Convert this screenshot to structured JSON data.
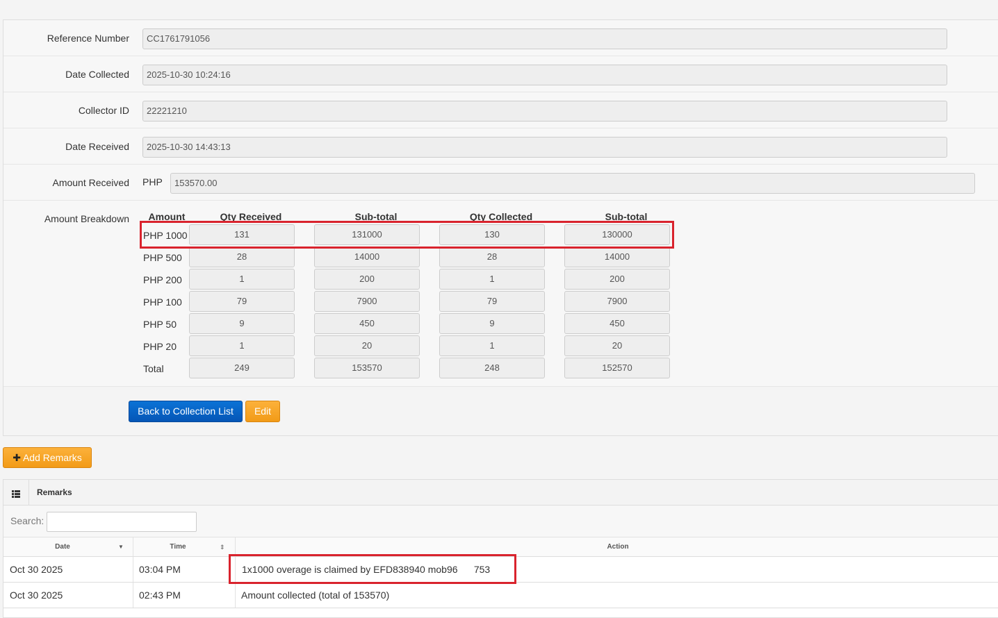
{
  "form": {
    "reference_number": {
      "label": "Reference Number",
      "value": "CC1761791056"
    },
    "date_collected": {
      "label": "Date Collected",
      "value": "2025-10-30 10:24:16"
    },
    "collector_id": {
      "label": "Collector ID",
      "value": "22221210"
    },
    "date_received": {
      "label": "Date Received",
      "value": "2025-10-30 14:43:13"
    },
    "amount_received": {
      "label": "Amount Received",
      "currency": "PHP",
      "value": "153570.00"
    }
  },
  "breakdown": {
    "label": "Amount Breakdown",
    "headers": [
      "Amount",
      "Qty Received",
      "Sub-total",
      "Qty Collected",
      "Sub-total"
    ],
    "rows": [
      {
        "amount": "PHP 1000",
        "qty_received": "131",
        "subtotal_received": "131000",
        "qty_collected": "130",
        "subtotal_collected": "130000"
      },
      {
        "amount": "PHP 500",
        "qty_received": "28",
        "subtotal_received": "14000",
        "qty_collected": "28",
        "subtotal_collected": "14000"
      },
      {
        "amount": "PHP 200",
        "qty_received": "1",
        "subtotal_received": "200",
        "qty_collected": "1",
        "subtotal_collected": "200"
      },
      {
        "amount": "PHP 100",
        "qty_received": "79",
        "subtotal_received": "7900",
        "qty_collected": "79",
        "subtotal_collected": "7900"
      },
      {
        "amount": "PHP 50",
        "qty_received": "9",
        "subtotal_received": "450",
        "qty_collected": "9",
        "subtotal_collected": "450"
      },
      {
        "amount": "PHP 20",
        "qty_received": "1",
        "subtotal_received": "20",
        "qty_collected": "1",
        "subtotal_collected": "20"
      },
      {
        "amount": "Total",
        "qty_received": "249",
        "subtotal_received": "153570",
        "qty_collected": "248",
        "subtotal_collected": "152570"
      }
    ]
  },
  "buttons": {
    "back": "Back to Collection List",
    "edit": "Edit",
    "add_remarks": "Add Remarks"
  },
  "remarks": {
    "title": "Remarks",
    "icon": "list-icon",
    "search_label": "Search:",
    "search_value": "",
    "columns": [
      "Date",
      "Time",
      "Action"
    ],
    "rows": [
      {
        "date": "Oct 30 2025",
        "time": "03:04 PM",
        "action": "1x1000 overage is claimed by EFD838940 mob96      753"
      },
      {
        "date": "Oct 30 2025",
        "time": "02:43 PM",
        "action": "Amount collected (total of 153570)"
      }
    ]
  },
  "colors": {
    "highlight": "#d9232d",
    "primary": "#0556b6",
    "warning": "#f29b17"
  }
}
